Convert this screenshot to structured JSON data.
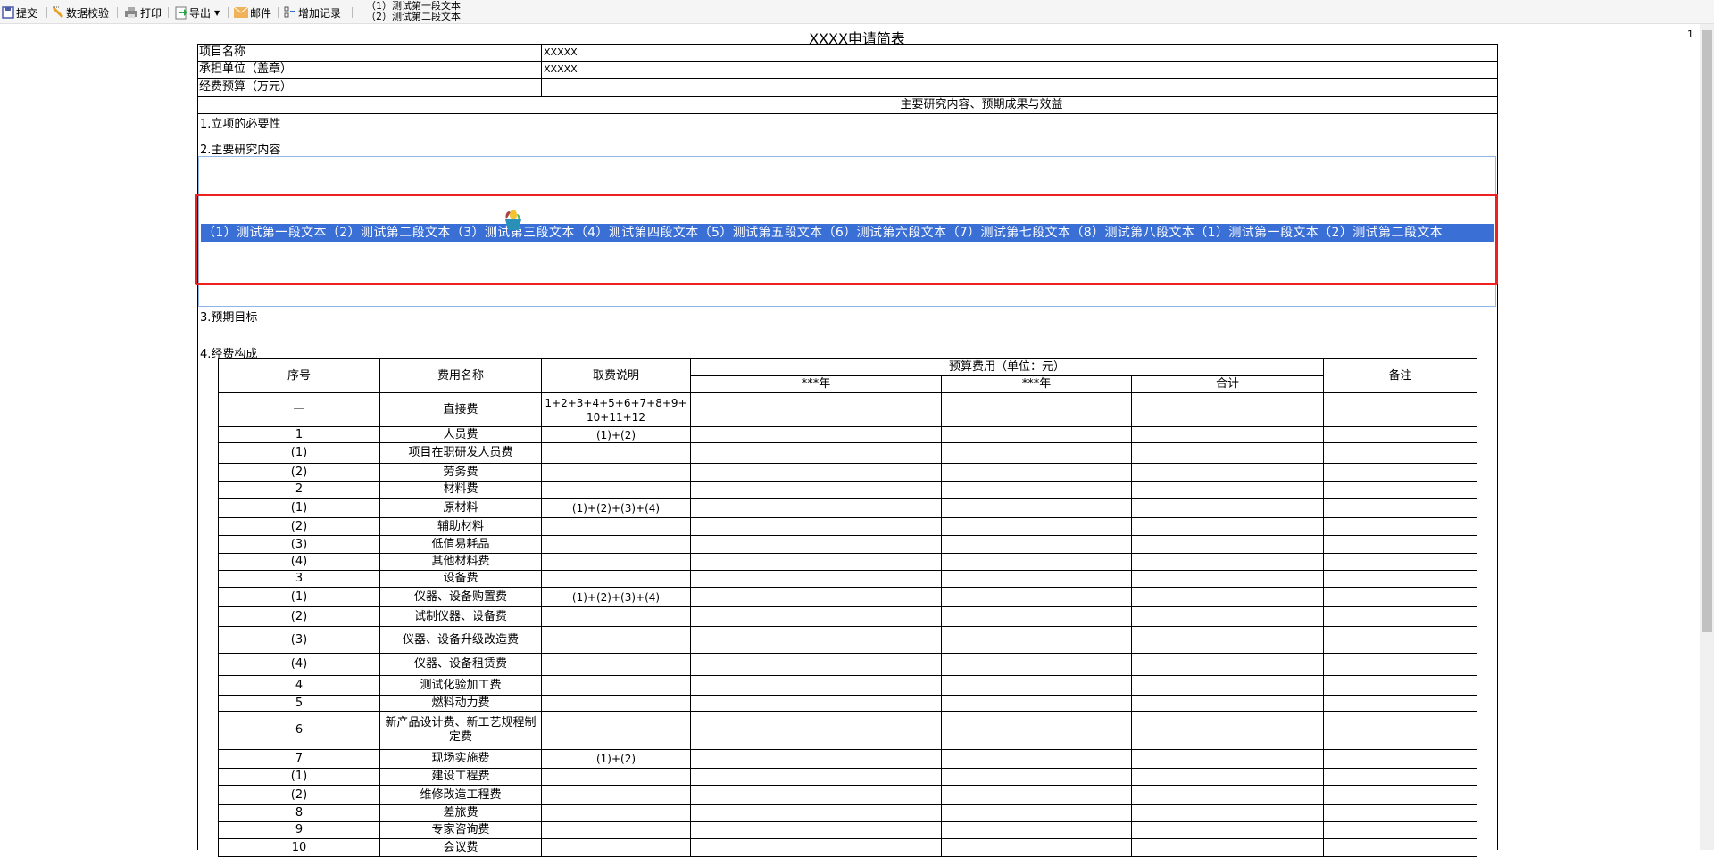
{
  "toolbar": {
    "items": [
      {
        "label": "提交",
        "icon": "save-icon"
      },
      {
        "label": "数据校验",
        "icon": "pencil-icon"
      },
      {
        "label": "打印",
        "icon": "printer-icon"
      },
      {
        "label": "导出",
        "icon": "export-icon"
      },
      {
        "label": "邮件",
        "icon": "mail-icon"
      },
      {
        "label": "增加记录",
        "icon": "add-record-icon"
      }
    ],
    "text_line1": "（1）测试第一段文本",
    "text_line2": "（2）测试第二段文本"
  },
  "page_number": "1",
  "title": "XXXX申请简表",
  "info": [
    {
      "label": "项目名称",
      "value": "XXXXX"
    },
    {
      "label": "承担单位（盖章）",
      "value": "XXXXX"
    },
    {
      "label": "经费预算（万元）",
      "value": ""
    }
  ],
  "section_header": "主要研究内容、预期成果与效益",
  "sections": {
    "s1": "1.立项的必要性",
    "s2": "2.主要研究内容",
    "s3": "3.预期目标",
    "s4": "4.经费构成"
  },
  "selected_text": "（1）测试第一段文本（2）测试第二段文本（3）测试第三段文本（4）测试第四段文本（5）测试第五段文本（6）测试第六段文本（7）测试第七段文本（8）测试第八段文本（1）测试第一段文本（2）测试第二段文本",
  "budget": {
    "headers": {
      "no": "序号",
      "name": "费用名称",
      "desc": "取费说明",
      "budget": "预算费用（单位：元）",
      "year1": "***年",
      "year2": "***年",
      "total": "合计",
      "note": "备注"
    },
    "rows": [
      {
        "no": "一",
        "name": "直接费",
        "desc": "1+2+3+4+5+6+7+8+9+10+11+12"
      },
      {
        "no": "1",
        "name": "人员费",
        "desc": "(1)+(2)"
      },
      {
        "no": "(1)",
        "name": "项目在职研发人员费",
        "desc": ""
      },
      {
        "no": "(2)",
        "name": "劳务费",
        "desc": ""
      },
      {
        "no": "2",
        "name": "材料费",
        "desc": ""
      },
      {
        "no": "(1)",
        "name": "原材料",
        "desc": "(1)+(2)+(3)+(4)"
      },
      {
        "no": "(2)",
        "name": "辅助材料",
        "desc": ""
      },
      {
        "no": "(3)",
        "name": "低值易耗品",
        "desc": ""
      },
      {
        "no": "(4)",
        "name": "其他材料费",
        "desc": ""
      },
      {
        "no": "3",
        "name": "设备费",
        "desc": ""
      },
      {
        "no": "(1)",
        "name": "仪器、设备购置费",
        "desc": "(1)+(2)+(3)+(4)"
      },
      {
        "no": "(2)",
        "name": "试制仪器、设备费",
        "desc": ""
      },
      {
        "no": "(3)",
        "name": "仪器、设备升级改造费",
        "desc": ""
      },
      {
        "no": "(4)",
        "name": "仪器、设备租赁费",
        "desc": ""
      },
      {
        "no": "4",
        "name": "测试化验加工费",
        "desc": ""
      },
      {
        "no": "5",
        "name": "燃料动力费",
        "desc": ""
      },
      {
        "no": "6",
        "name": "新产品设计费、新工艺规程制定费",
        "desc": ""
      },
      {
        "no": "7",
        "name": "现场实施费",
        "desc": "(1)+(2)"
      },
      {
        "no": "(1)",
        "name": "建设工程费",
        "desc": ""
      },
      {
        "no": "(2)",
        "name": "维修改造工程费",
        "desc": ""
      },
      {
        "no": "8",
        "name": "差旅费",
        "desc": ""
      },
      {
        "no": "9",
        "name": "专家咨询费",
        "desc": ""
      },
      {
        "no": "10",
        "name": "会议费",
        "desc": ""
      }
    ]
  }
}
